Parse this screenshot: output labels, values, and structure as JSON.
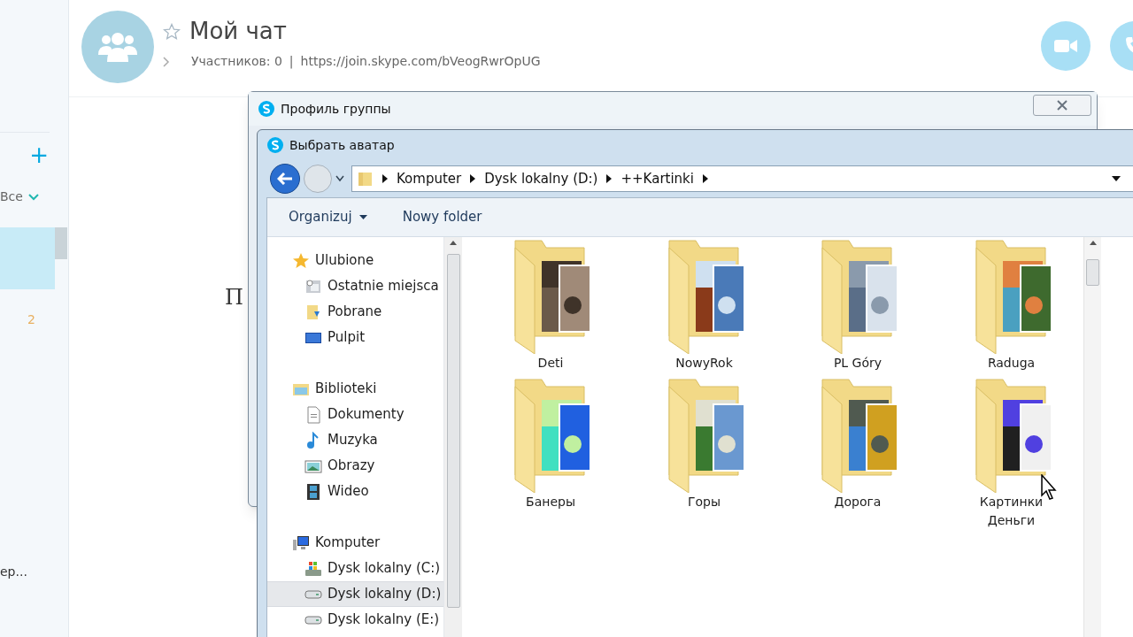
{
  "skype": {
    "sidebar": {
      "add": "+",
      "filter": "Все",
      "badge": "2",
      "item_text": "ер..."
    },
    "chat": {
      "title": "Мой чат",
      "participants": "Участников: 0",
      "separator": "|",
      "link": "https://join.skype.com/bVeogRwrOpUG",
      "body_text": "П"
    }
  },
  "group_profile": {
    "title": "Профиль группы"
  },
  "picker": {
    "title": "Выбрать аватар",
    "breadcrumb": [
      "Komputer",
      "Dysk lokalny (D:)",
      "++Kartinki"
    ],
    "toolbar": [
      {
        "label": "Organizuj",
        "dropdown": true
      },
      {
        "label": "Nowy folder",
        "dropdown": false
      }
    ],
    "nav": [
      {
        "label": "Ulubione",
        "kind": "star",
        "selected": false,
        "children": [
          {
            "label": "Ostatnie miejsca",
            "kind": "recent",
            "selected": false
          },
          {
            "label": "Pobrane",
            "kind": "download",
            "selected": false
          },
          {
            "label": "Pulpit",
            "kind": "desktop",
            "selected": false
          }
        ]
      },
      {
        "label": "Biblioteki",
        "kind": "library",
        "selected": false,
        "children": [
          {
            "label": "Dokumenty",
            "kind": "document",
            "selected": false
          },
          {
            "label": "Muzyka",
            "kind": "music",
            "selected": false
          },
          {
            "label": "Obrazy",
            "kind": "image",
            "selected": false
          },
          {
            "label": "Wideo",
            "kind": "video",
            "selected": false
          }
        ]
      },
      {
        "label": "Komputer",
        "kind": "computer",
        "selected": false,
        "children": [
          {
            "label": "Dysk lokalny (C:)",
            "kind": "system_drive",
            "selected": false
          },
          {
            "label": "Dysk lokalny (D:)",
            "kind": "drive",
            "selected": true
          },
          {
            "label": "Dysk lokalny (E:)",
            "kind": "drive",
            "selected": false
          }
        ]
      }
    ],
    "folders": [
      {
        "name": "Deti"
      },
      {
        "name": "NowyRok"
      },
      {
        "name": "PL Góry"
      },
      {
        "name": "Raduga"
      },
      {
        "name": "Банеры"
      },
      {
        "name": "Горы"
      },
      {
        "name": "Дорога"
      },
      {
        "name": "Картинки Деньги"
      }
    ]
  }
}
